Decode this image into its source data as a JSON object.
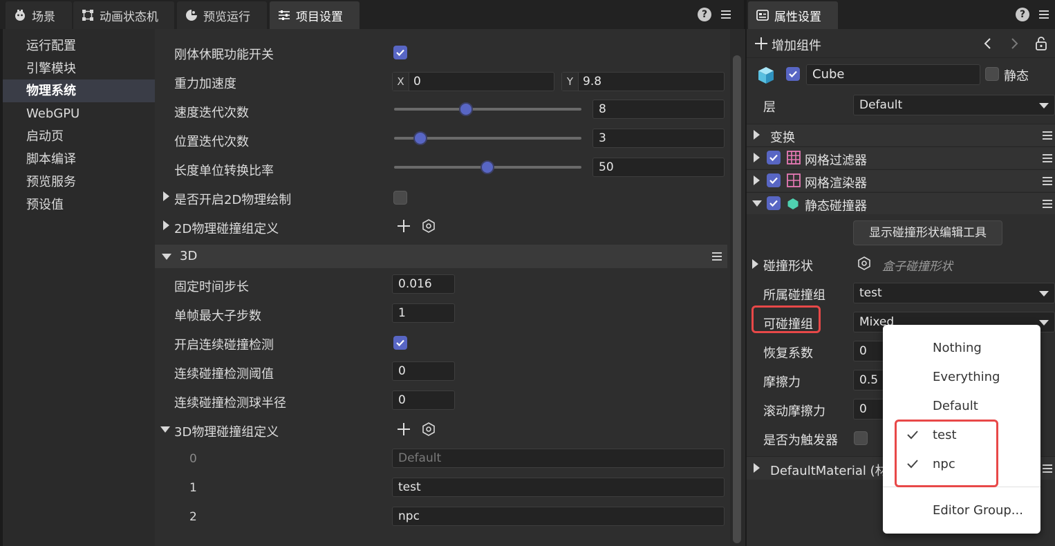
{
  "tabs": [
    {
      "label": "场景",
      "icon": "scene-icon"
    },
    {
      "label": "动画状态机",
      "icon": "animator-icon"
    },
    {
      "label": "预览运行",
      "icon": "preview-icon"
    },
    {
      "label": "项目设置",
      "icon": "settings-sliders-icon",
      "active": true
    }
  ],
  "nav": {
    "items": [
      "运行配置",
      "引擎模块",
      "物理系统",
      "WebGPU",
      "启动页",
      "脚本编译",
      "预览服务",
      "预设值"
    ],
    "active": "物理系统"
  },
  "physics2d": {
    "sleep_label": "刚体休眠功能开关",
    "gravity_label": "重力加速度",
    "gravity_x_label": "X",
    "gravity_x": "0",
    "gravity_y_label": "Y",
    "gravity_y": "9.8",
    "velocity_iter_label": "速度迭代次数",
    "velocity_iter": "8",
    "position_iter_label": "位置迭代次数",
    "position_iter": "3",
    "unit_ratio_label": "长度单位转换比率",
    "unit_ratio": "50",
    "debug_draw_label": "是否开启2D物理绘制",
    "groups2d_label": "2D物理碰撞组定义"
  },
  "physics3d": {
    "section_title": "3D",
    "fixed_step_label": "固定时间步长",
    "fixed_step": "0.016",
    "max_substeps_label": "单帧最大子步数",
    "max_substeps": "1",
    "ccd_label": "开启连续碰撞检测",
    "ccd_threshold_label": "连续碰撞检测阈值",
    "ccd_threshold": "0",
    "ccd_radius_label": "连续碰撞检测球半径",
    "ccd_radius": "0",
    "groups3d_label": "3D物理碰撞组定义",
    "groups": [
      {
        "index": "0",
        "placeholder": "Default",
        "value": ""
      },
      {
        "index": "1",
        "value": "test"
      },
      {
        "index": "2",
        "value": "npc"
      }
    ]
  },
  "inspector": {
    "title": "属性设置",
    "add_component": "增加组件",
    "node_name": "Cube",
    "static_label": "静态",
    "layer_label": "层",
    "layer_value": "Default",
    "components": [
      {
        "label": "变换"
      },
      {
        "label": "网格过滤器"
      },
      {
        "label": "网格渲染器"
      },
      {
        "label": "静态碰撞器"
      }
    ],
    "show_shape_tool": "显示碰撞形状编辑工具",
    "shape_label": "碰撞形状",
    "shape_value": "盒子碰撞形状",
    "group_label": "所属碰撞组",
    "group_value": "test",
    "mask_label": "可碰撞组",
    "mask_value": "Mixed",
    "restitution_label": "恢复系数",
    "restitution": "0",
    "friction_label": "摩擦力",
    "friction": "0.5",
    "rolling_friction_label": "滚动摩擦力",
    "rolling_friction": "0",
    "trigger_label": "是否为触发器",
    "material_label": "DefaultMaterial (材质"
  },
  "dropdown": {
    "options": [
      {
        "label": "Nothing",
        "checked": false
      },
      {
        "label": "Everything",
        "checked": false
      },
      {
        "label": "Default",
        "checked": false
      },
      {
        "label": "test",
        "checked": true
      },
      {
        "label": "npc",
        "checked": true
      }
    ],
    "footer": "Editor Group..."
  },
  "colors": {
    "accent": "#5866c4",
    "highlight": "#e84848"
  }
}
